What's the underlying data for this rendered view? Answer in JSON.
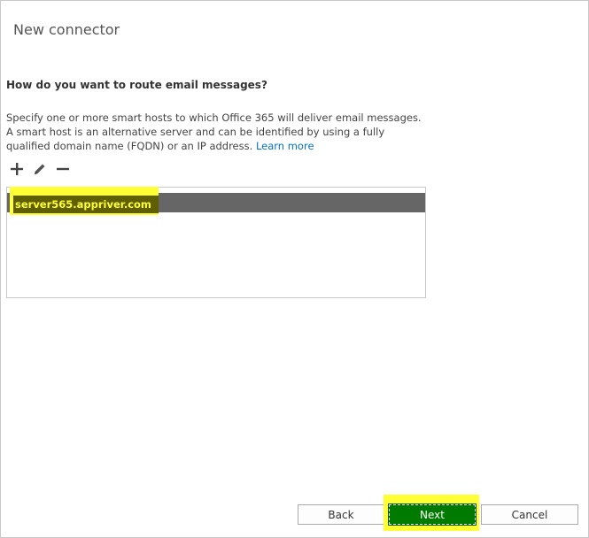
{
  "dialog": {
    "title": "New connector",
    "question": "How do you want to route email messages?",
    "description": "Specify one or more smart hosts to which Office 365 will deliver email messages. A smart host is an alternative server and can be identified by using a fully qualified domain name (FQDN) or an IP address.",
    "learn_more": "Learn more"
  },
  "toolbar": {
    "add_icon": "plus-icon",
    "edit_icon": "pencil-icon",
    "remove_icon": "minus-icon"
  },
  "smart_hosts": {
    "items": [
      "server565.appriver.com"
    ],
    "selected_index": 0
  },
  "footer": {
    "back_label": "Back",
    "next_label": "Next",
    "cancel_label": "Cancel"
  },
  "colors": {
    "highlight": "#ffff33",
    "next_button": "#007a00",
    "link": "#0072c6",
    "selected_row": "#666666"
  }
}
